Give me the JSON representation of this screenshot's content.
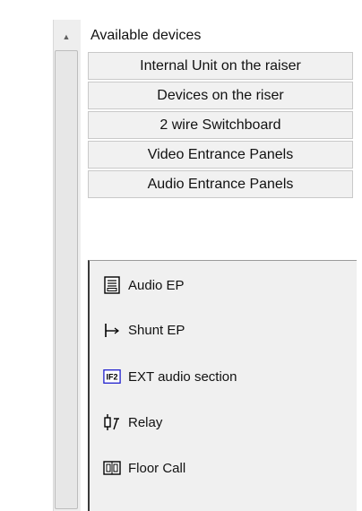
{
  "header": {
    "title": "Available devices"
  },
  "categories": [
    {
      "label": "Internal Unit on the raiser"
    },
    {
      "label": "Devices on the riser"
    },
    {
      "label": "2 wire Switchboard"
    },
    {
      "label": "Video Entrance Panels"
    },
    {
      "label": "Audio Entrance Panels"
    }
  ],
  "devices": [
    {
      "label": "Audio EP",
      "icon": "audio-ep-icon"
    },
    {
      "label": "Shunt EP",
      "icon": "shunt-icon"
    },
    {
      "label": "EXT audio section",
      "icon": "if2-icon",
      "icon_text": "IF2"
    },
    {
      "label": "Relay",
      "icon": "relay-icon"
    },
    {
      "label": "Floor Call",
      "icon": "floor-call-icon"
    }
  ]
}
